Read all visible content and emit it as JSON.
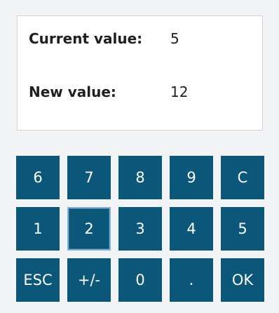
{
  "display": {
    "current_label": "Current value:",
    "current_value": "5",
    "new_label": "New value:",
    "new_value": "12"
  },
  "keypad": {
    "rows": [
      [
        "6",
        "7",
        "8",
        "9",
        "C"
      ],
      [
        "1",
        "2",
        "3",
        "4",
        "5"
      ],
      [
        "ESC",
        "+/-",
        "0",
        ".",
        "OK"
      ]
    ],
    "focused_key": "2"
  }
}
